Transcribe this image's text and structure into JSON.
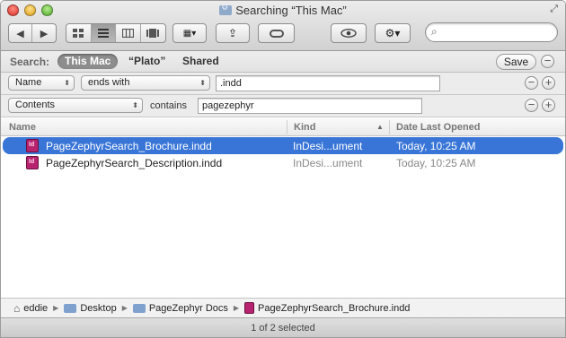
{
  "window": {
    "title": "Searching “This Mac”"
  },
  "toolbar": {
    "back_glyph": "◀",
    "forward_glyph": "▶",
    "view_icons": [
      "grid-icon",
      "list-icon",
      "columns-icon",
      "coverflow-icon"
    ],
    "arrange_glyph": "▦▾",
    "share_glyph": "⇪",
    "quicklook_glyph": "👁",
    "action_glyph": "⚙▾",
    "search_value": "",
    "search_icon": "magnifier-icon"
  },
  "scope": {
    "label": "Search:",
    "options": [
      "This Mac",
      "“Plato”",
      "Shared"
    ],
    "selected": "This Mac",
    "save_label": "Save"
  },
  "criteria": [
    {
      "attribute": "Name",
      "operator": "ends with",
      "value": ".indd"
    },
    {
      "attribute": "Contents",
      "operator": "contains",
      "value": "pagezephyr"
    }
  ],
  "columns": {
    "name": "Name",
    "kind": "Kind",
    "date": "Date Last Opened",
    "sort_glyph": "▲"
  },
  "files": [
    {
      "name": "PageZephyrSearch_Brochure.indd",
      "kind": "InDesi...ument",
      "date": "Today, 10:25 AM",
      "selected": true
    },
    {
      "name": "PageZephyrSearch_Description.indd",
      "kind": "InDesi...ument",
      "date": "Today, 10:25 AM",
      "selected": false
    }
  ],
  "path": [
    "eddie",
    "Desktop",
    "PageZephyr Docs",
    "PageZephyrSearch_Brochure.indd"
  ],
  "status": "1 of 2 selected",
  "colors": {
    "selection": "#3875d7",
    "indesign_icon": "#b7236e"
  }
}
